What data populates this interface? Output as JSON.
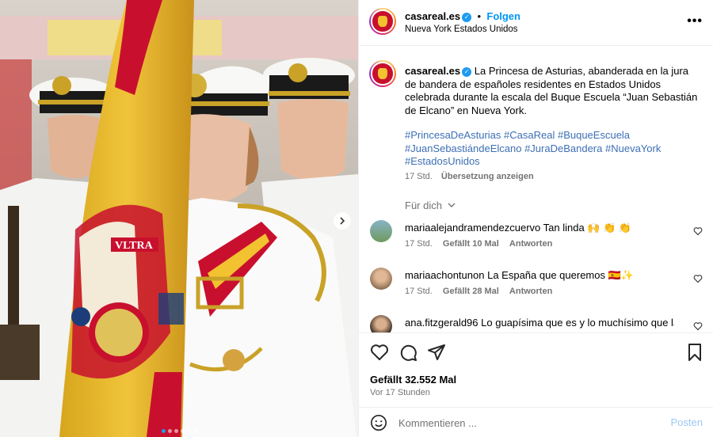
{
  "post": {
    "author": "casareal.es",
    "verified": true,
    "follow_label": "Folgen",
    "bullet": "•",
    "location": "Nueva York Estados Unidos",
    "more_label": "•••",
    "caption": "La Princesa de Asturias, abanderada en la jura de bandera de españoles residentes en Estados Unidos celebrada durante la escala del Buque Escuela “Juan Sebastián de Elcano” en Nueva York.",
    "hashtags": [
      "#PrincesaDeAsturias",
      "#CasaReal",
      "#BuqueEscuela",
      "#JuanSebastiándeElcano",
      "#JuraDeBandera",
      "#NuevaYork",
      "#EstadosUnidos"
    ],
    "caption_time": "17 Std.",
    "translate_label": "Übersetzung anzeigen",
    "for_you_label": "Für dich",
    "likes": "Gefällt 32.552 Mal",
    "posted_ago": "Vor 17 Stunden",
    "brand_color": "#c8102e",
    "accent_color": "#0095f6"
  },
  "comments": [
    {
      "user": "mariaalejandramendezcuervo",
      "text": "Tan linda 🙌 👏 👏",
      "time": "17 Std.",
      "likes": "Gefällt 10 Mal",
      "reply": "Antworten"
    },
    {
      "user": "mariaachontunon",
      "text": "La España que queremos 🇪🇸✨",
      "time": "17 Std.",
      "likes": "Gefällt 28 Mal",
      "reply": "Antworten"
    },
    {
      "user": "ana.fitzgerald96",
      "text": "Lo guapísima que es y lo muchísimo que la",
      "time": "",
      "likes": "",
      "reply": ""
    }
  ],
  "composer": {
    "placeholder": "Kommentieren ...",
    "post_label": "Posten"
  },
  "media": {
    "slide_count": 6,
    "active_slide": 1,
    "flag_text": "VLTRA"
  }
}
